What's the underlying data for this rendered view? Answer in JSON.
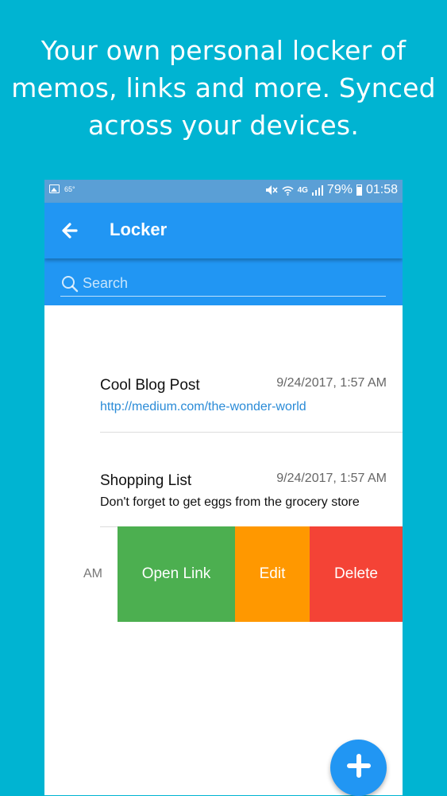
{
  "promo": {
    "lines": [
      "Your own personal locker of",
      "memos, links and more. Synced",
      "across your devices."
    ]
  },
  "status_bar": {
    "temperature": "65°",
    "battery": "79%",
    "time": "01:58",
    "network": "4G"
  },
  "app_bar": {
    "title": "Locker"
  },
  "search": {
    "placeholder": "Search",
    "value": ""
  },
  "items": [
    {
      "title": "Cool Blog Post",
      "date": "9/24/2017, 1:57 AM",
      "content": "http://medium.com/the-wonder-world"
    },
    {
      "title": "Shopping List",
      "date": "9/24/2017, 1:57 AM",
      "content": "Don't forget to get eggs from the grocery store"
    }
  ],
  "swiped_item": {
    "peek_text": "AM",
    "actions": {
      "open_link": "Open Link",
      "edit": "Edit",
      "delete": "Delete"
    }
  },
  "colors": {
    "background": "#00b4d2",
    "primary": "#2196f3",
    "open_link": "#4caf50",
    "edit": "#ff9800",
    "delete": "#f44336",
    "link": "#2a8bd7"
  },
  "icons": {
    "back": "arrow-left-icon",
    "search": "search-icon",
    "fab": "plus-icon"
  }
}
